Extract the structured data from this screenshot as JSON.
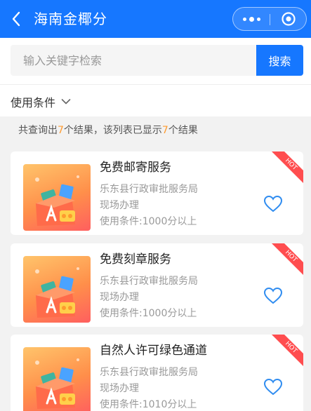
{
  "header": {
    "title": "海南金椰分"
  },
  "search": {
    "placeholder": "输入关键字检索",
    "button": "搜索"
  },
  "filter": {
    "label": "使用条件"
  },
  "result": {
    "prefix": "共查询出",
    "total": "7",
    "middle": "个结果，该列表已显示",
    "shown": "7",
    "suffix": "个结果"
  },
  "items": [
    {
      "name": "免费邮寄服务",
      "dept": "乐东县行政审批服务局",
      "mode": "现场办理",
      "condition": "使用条件:1000分以上",
      "badge": "HOT"
    },
    {
      "name": "免费刻章服务",
      "dept": "乐东县行政审批服务局",
      "mode": "现场办理",
      "condition": "使用条件:1000分以上",
      "badge": "HOT"
    },
    {
      "name": "自然人许可绿色通道",
      "dept": "乐东县行政审批服务局",
      "mode": "现场办理",
      "condition": "使用条件:1010分以上",
      "badge": "HOT"
    }
  ],
  "colors": {
    "primary": "#1677ff",
    "highlight": "#ff9a2e",
    "hot": "#ff4d4f"
  },
  "icons": {
    "back": "chevron-left-icon",
    "more": "more-dots-icon",
    "close": "target-close-icon",
    "filter": "chevron-down-icon",
    "favorite": "heart-outline-icon"
  }
}
